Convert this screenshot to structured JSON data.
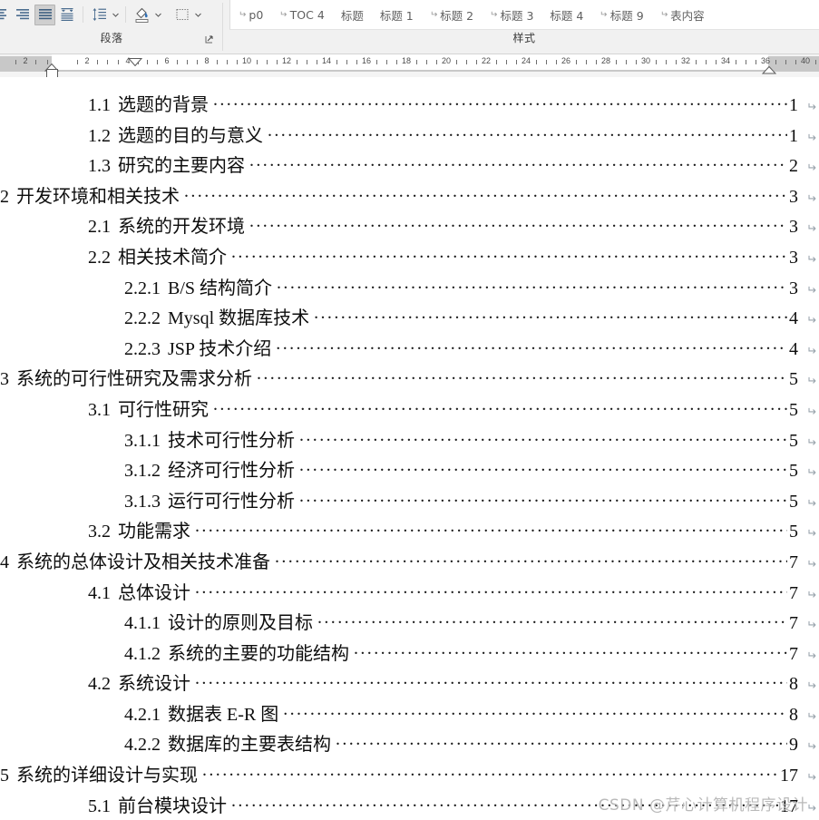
{
  "ribbon": {
    "paragraph_group": {
      "label": "段落",
      "dialog_launcher_name": "paragraph-dialog-launcher",
      "buttons": [
        {
          "name": "align-center-icon",
          "label": "居中",
          "active": false
        },
        {
          "name": "align-right-icon",
          "label": "右对齐",
          "active": false
        },
        {
          "name": "justify-icon",
          "label": "两端对齐",
          "active": true
        },
        {
          "name": "distributed-icon",
          "label": "分散对齐",
          "active": false
        },
        {
          "name": "line-spacing-icon",
          "label": "行和段落间距",
          "active": false
        },
        {
          "name": "shading-icon",
          "label": "底纹",
          "active": false
        },
        {
          "name": "borders-icon",
          "label": "边框",
          "active": false
        }
      ]
    },
    "styles_group": {
      "label": "样式",
      "items": [
        {
          "name": "p0",
          "label": "p0",
          "pilcrow": true
        },
        {
          "name": "toc-4",
          "label": "TOC 4",
          "pilcrow": true
        },
        {
          "name": "biaoti",
          "label": "标题",
          "pilcrow": false
        },
        {
          "name": "biaoti-1",
          "label": "标题 1",
          "pilcrow": false
        },
        {
          "name": "biaoti-2",
          "label": "标题 2",
          "pilcrow": true
        },
        {
          "name": "biaoti-3",
          "label": "标题 3",
          "pilcrow": true
        },
        {
          "name": "biaoti-4",
          "label": "标题 4",
          "pilcrow": false
        },
        {
          "name": "biaoti-9",
          "label": "标题 9",
          "pilcrow": true
        },
        {
          "name": "biao-neirong",
          "label": "表内容",
          "pilcrow": true
        }
      ]
    }
  },
  "ruler": {
    "numbers": [
      "2",
      "2",
      "4",
      "6",
      "8",
      "10",
      "12",
      "14",
      "16",
      "18",
      "20",
      "22",
      "24",
      "26",
      "28",
      "30",
      "32",
      "34",
      "36",
      "40"
    ],
    "left_indent_marker": "first-line-indent-marker",
    "hanging_indent_marker": "hanging-indent-marker",
    "tab_marker": "tab-stop-marker",
    "right_indent_marker": "right-indent-marker"
  },
  "document": {
    "leader_char": ".",
    "pilcrow": "↵",
    "toc_entries": [
      {
        "num": "1.1",
        "title": "选题的背景",
        "page": "1",
        "level": 1
      },
      {
        "num": "1.2",
        "title": "选题的目的与意义",
        "page": "1",
        "level": 1
      },
      {
        "num": "1.3",
        "title": "研究的主要内容",
        "page": "2",
        "level": 1
      },
      {
        "num": "2",
        "title": "开发环境和相关技术",
        "page": "3",
        "level": 0
      },
      {
        "num": "2.1",
        "title": "系统的开发环境",
        "page": "3",
        "level": 1
      },
      {
        "num": "2.2",
        "title": "相关技术简介",
        "page": "3",
        "level": 1
      },
      {
        "num": "2.2.1",
        "title": "B/S 结构简介",
        "page": "3",
        "level": 2
      },
      {
        "num": "2.2.2",
        "title": "Mysql 数据库技术",
        "page": "4",
        "level": 2
      },
      {
        "num": "2.2.3",
        "title": "JSP 技术介绍",
        "page": "4",
        "level": 2
      },
      {
        "num": "3",
        "title": "系统的可行性研究及需求分析",
        "page": "5",
        "level": 0
      },
      {
        "num": "3.1",
        "title": "可行性研究",
        "page": "5",
        "level": 1
      },
      {
        "num": "3.1.1",
        "title": "技术可行性分析",
        "page": "5",
        "level": 2
      },
      {
        "num": "3.1.2",
        "title": "经济可行性分析",
        "page": "5",
        "level": 2
      },
      {
        "num": "3.1.3",
        "title": "运行可行性分析",
        "page": "5",
        "level": 2
      },
      {
        "num": "3.2",
        "title": "功能需求",
        "page": "5",
        "level": 1
      },
      {
        "num": "4",
        "title": "系统的总体设计及相关技术准备",
        "page": "7",
        "level": 0
      },
      {
        "num": "4.1",
        "title": "总体设计",
        "page": "7",
        "level": 1
      },
      {
        "num": "4.1.1",
        "title": "设计的原则及目标",
        "page": "7",
        "level": 2
      },
      {
        "num": "4.1.2",
        "title": "系统的主要的功能结构",
        "page": "7",
        "level": 2
      },
      {
        "num": "4.2",
        "title": "系统设计",
        "page": "8",
        "level": 1
      },
      {
        "num": "4.2.1",
        "title": "数据表 E-R 图",
        "page": "8",
        "level": 2
      },
      {
        "num": "4.2.2",
        "title": "数据库的主要表结构",
        "page": "9",
        "level": 2
      },
      {
        "num": "5",
        "title": "系统的详细设计与实现",
        "page": "17",
        "level": 0
      },
      {
        "num": "5.1",
        "title": "前台模块设计",
        "page": "17",
        "level": 1
      }
    ]
  },
  "watermark": {
    "text": "CSDN @芹心计算机程序设计"
  },
  "colors": {
    "ribbon_bg": "#f1f1f1",
    "gallery_bg": "#ffffff",
    "ruler_bg": "#f4f4f4",
    "ruler_margin": "#c8c8c8",
    "doc_bg": "#ffffff",
    "text": "#0d0d0d",
    "pilcrow": "#9aa4ad",
    "watermark": "#b9b9b9",
    "active_button": "#cfcfcf"
  }
}
